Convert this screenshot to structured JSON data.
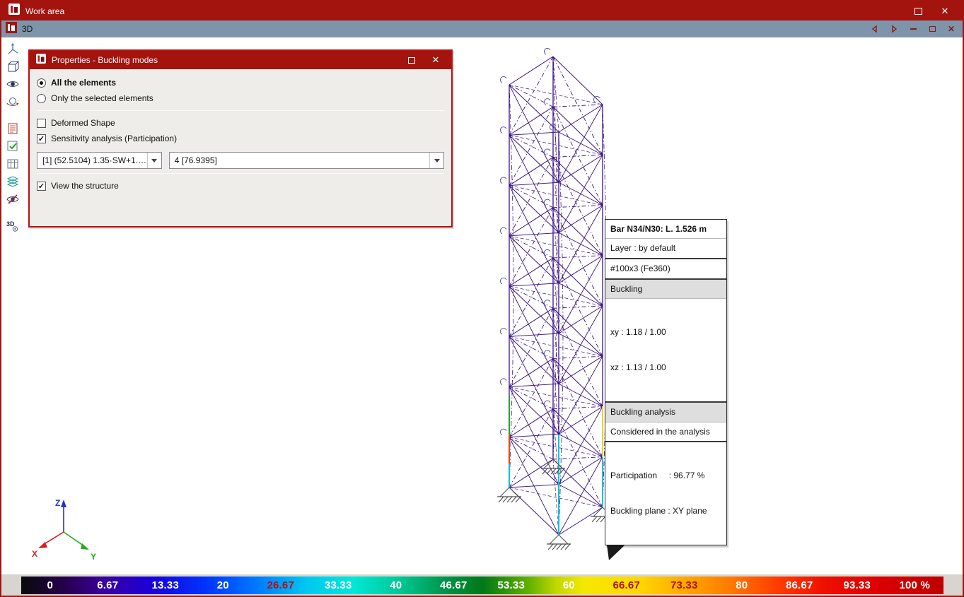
{
  "window": {
    "title": "Work area"
  },
  "viewport": {
    "title": "3D"
  },
  "sidebar": {
    "icons": [
      "axes-icon",
      "cube-icon",
      "eye-icon",
      "orbit-icon",
      "results-table-icon",
      "check-table-icon",
      "grid-icon",
      "layers-icon",
      "hide-elements-icon",
      "3d-options-icon"
    ]
  },
  "dialog": {
    "title": "Properties - Buckling modes",
    "radio_all": "All the elements",
    "radio_selected": "Only the selected elements",
    "chk_deformed": "Deformed Shape",
    "chk_sensitivity": "Sensitivity analysis (Participation)",
    "combo_loadcase": "[1] (52.5104) 1.35·SW+1.5-...",
    "combo_mode": "4 [76.9395]",
    "chk_view": "View the structure"
  },
  "tooltip": {
    "title": "Bar N34/N30: L. 1.526 m",
    "layer": "Layer : by default",
    "section": "#100x3 (Fe360)",
    "buckling_header": "Buckling",
    "xy": "xy : 1.18 / 1.00",
    "xz": "xz : 1.13 / 1.00",
    "analysis_header": "Buckling analysis",
    "considered": "Considered in the analysis",
    "participation": "Participation     : 96.77 %",
    "plane": "Buckling plane : XY plane"
  },
  "axes": {
    "x": "X",
    "y": "Y",
    "z": "Z"
  },
  "scale": {
    "labels": [
      {
        "text": "0",
        "style": "color:#FFFFFF"
      },
      {
        "text": "6.67",
        "style": "color:#FFFFFF"
      },
      {
        "text": "13.33",
        "style": "color:#FFFFFF"
      },
      {
        "text": "20",
        "style": "color:#FFFFFF"
      },
      {
        "text": "26.67",
        "style": "color:#B01010"
      },
      {
        "text": "33.33",
        "style": "color:#FFFFFF"
      },
      {
        "text": "40",
        "style": "color:#FFFFFF"
      },
      {
        "text": "46.67",
        "style": "color:#FFFFFF"
      },
      {
        "text": "53.33",
        "style": "color:#FFFFFF"
      },
      {
        "text": "60",
        "style": "color:#FFFFFF"
      },
      {
        "text": "66.67",
        "style": "color:#B01010"
      },
      {
        "text": "73.33",
        "style": "color:#B01010"
      },
      {
        "text": "80",
        "style": "color:#FFFFFF"
      },
      {
        "text": "86.67",
        "style": "color:#FFFFFF"
      },
      {
        "text": "93.33",
        "style": "color:#FFFFFF"
      },
      {
        "text": "100 %",
        "style": "color:#FFFFFF"
      }
    ]
  },
  "colors": {
    "titlebar": "#A3140E",
    "dialog_border": "#C00D0D",
    "mdi_bar": "#7D94AA",
    "structure": "#3B1386",
    "cyan": "#00C4D6",
    "yellow": "#EED500",
    "red": "#E8480E",
    "green": "#2AA02A",
    "support": "#4A4A4A"
  }
}
